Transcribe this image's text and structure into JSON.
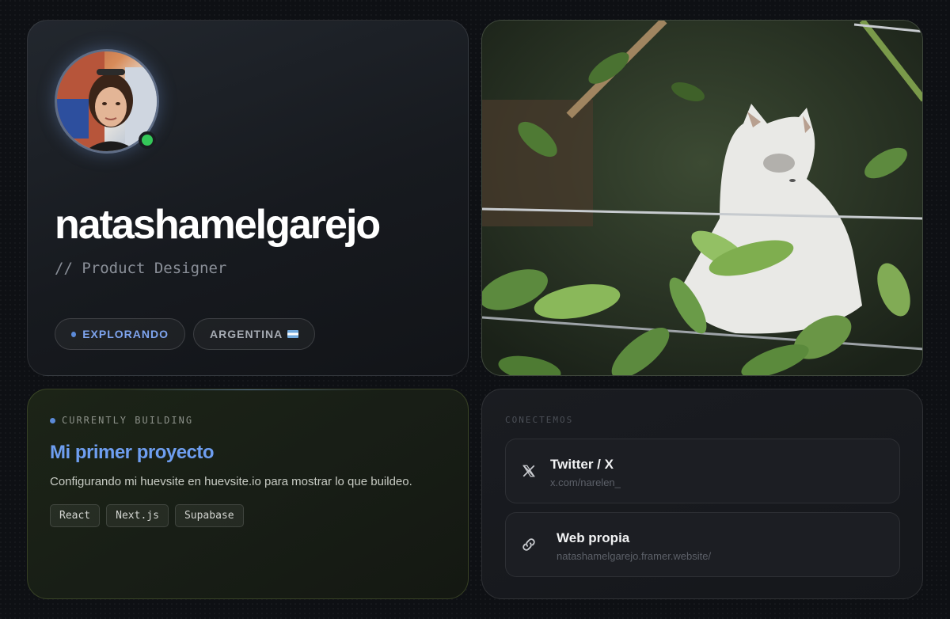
{
  "profile": {
    "name": "natashamelgarejo",
    "role": "// Product Designer",
    "status_pill": "EXPLORANDO",
    "country_pill": "ARGENTINA",
    "online_color": "#34c759",
    "avatar_alt": "Avatar de Natasha"
  },
  "photo": {
    "subject": "cat-among-leaves"
  },
  "building": {
    "label": "CURRENTLY BUILDING",
    "title": "Mi primer proyecto",
    "description": "Configurando mi huevsite en huevsite.io para mostrar lo que buildeo.",
    "tags": [
      "React",
      "Next.js",
      "Supabase"
    ]
  },
  "connect": {
    "label": "CONECTEMOS",
    "links": [
      {
        "title": "Twitter / X",
        "subtitle": "x.com/narelen_",
        "icon": "x-logo-icon"
      },
      {
        "title": "Web propia",
        "subtitle": "natashamelgarejo.framer.website/",
        "icon": "link-icon"
      }
    ]
  },
  "colors": {
    "accent": "#6e9ef0",
    "background": "#0e1014"
  }
}
